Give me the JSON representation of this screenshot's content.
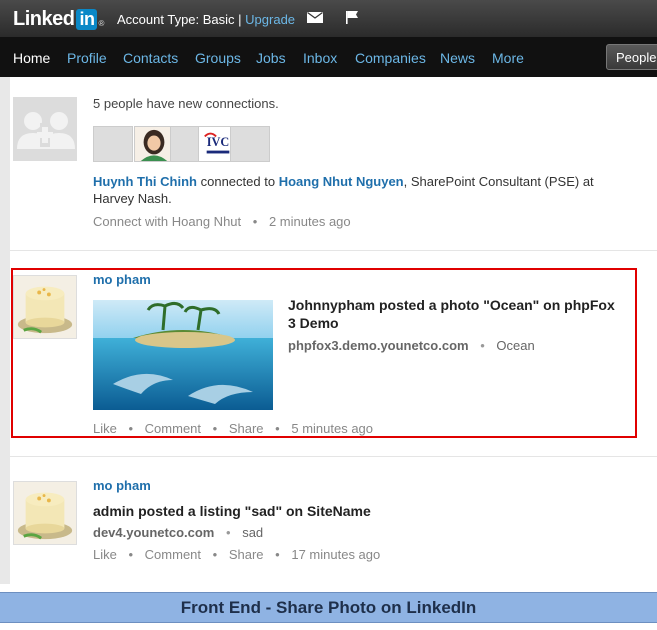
{
  "header": {
    "logo_text": "Linked",
    "logo_in": "in",
    "logo_reg": "®",
    "account_type": "Account Type: Basic |",
    "upgrade": "Upgrade"
  },
  "nav": {
    "items": [
      "Home",
      "Profile",
      "Contacts",
      "Groups",
      "Jobs",
      "Inbox",
      "Companies",
      "News",
      "More"
    ],
    "people_button": "People"
  },
  "feed": {
    "connections": {
      "summary": "5 people have new connections.",
      "actor": "Huynh Thi Chinh",
      "connected_to": "connected to",
      "target": "Hoang Nhut Nguyen",
      "target_desc_line1": ", SharePoint Consultant (PSE) at",
      "target_desc_line2": "Harvey Nash.",
      "connect_link": "Connect with Hoang Nhut",
      "time": "2 minutes ago"
    },
    "photo_post": {
      "author": "mo pham",
      "title_line1": "Johnnypham posted a photo \"Ocean\" on phpFox",
      "title_line2": "3 Demo",
      "domain": "phpfox3.demo.younetco.com",
      "subtitle": "Ocean",
      "actions": [
        "Like",
        "Comment",
        "Share"
      ],
      "time": "5 minutes ago"
    },
    "listing_post": {
      "author": "mo pham",
      "title": "admin posted a listing \"sad\" on SiteName",
      "domain": "dev4.younetco.com",
      "subtitle": "sad",
      "actions": [
        "Like",
        "Comment",
        "Share"
      ],
      "time": "17 minutes ago"
    }
  },
  "caption": "Front End - Share Photo on LinkedIn",
  "colors": {
    "link_blue": "#1f6fab",
    "nav_blue": "#6cb7e6",
    "highlight_red": "#e00000",
    "caption_bg": "#8fb3e3"
  }
}
